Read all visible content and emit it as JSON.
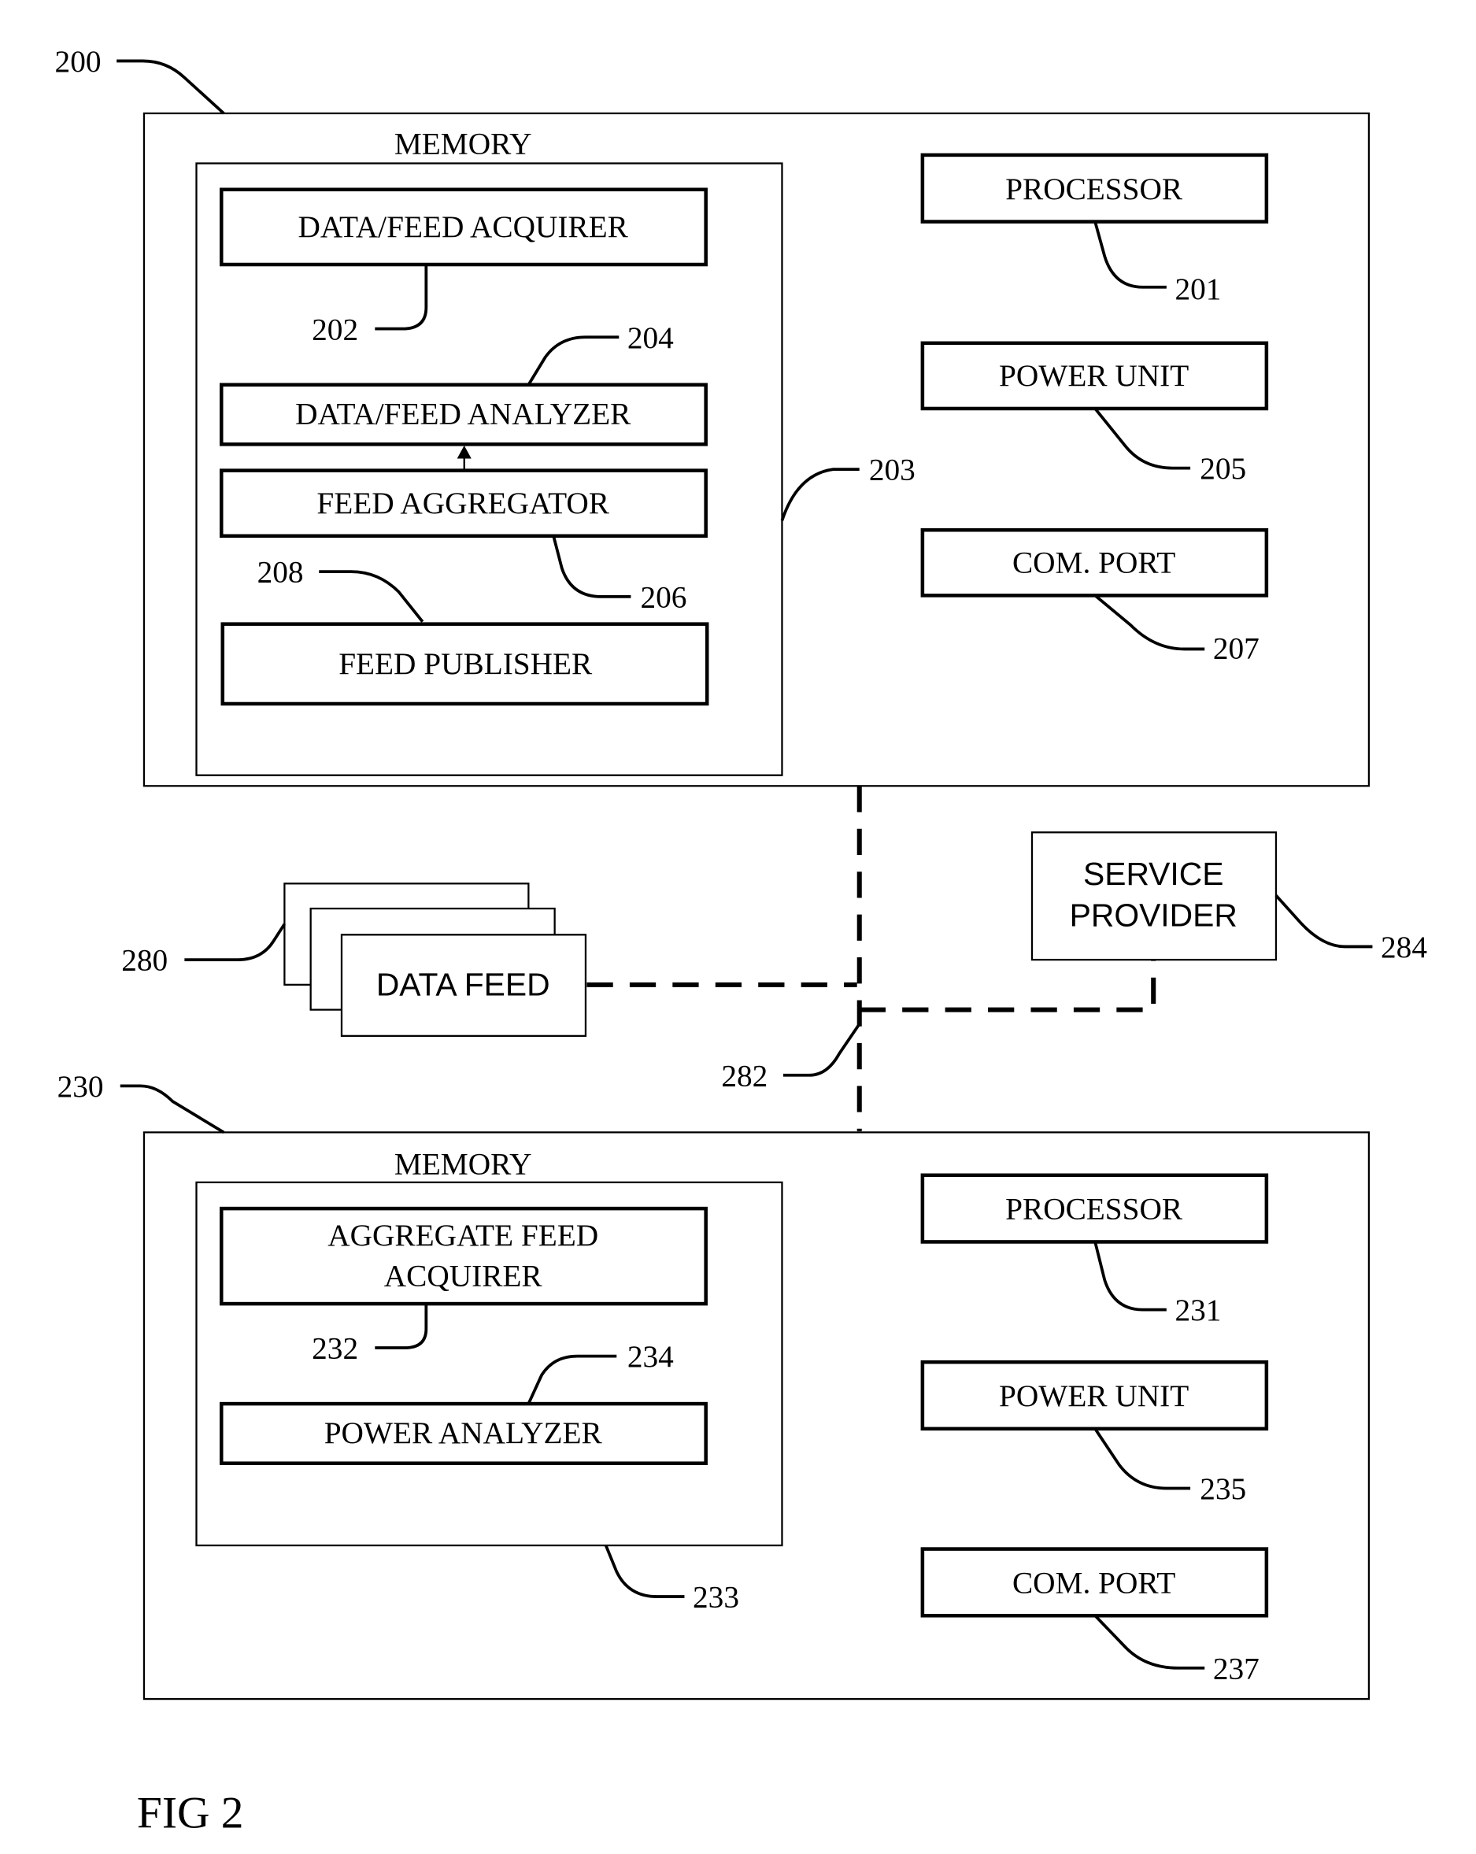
{
  "figure_label": "FIG 2",
  "device_200": {
    "ref": "200",
    "memory": {
      "title": "MEMORY",
      "ref": "203",
      "modules": [
        {
          "label": "DATA/FEED ACQUIRER",
          "ref": "202"
        },
        {
          "label": "DATA/FEED ANALYZER",
          "ref": "204"
        },
        {
          "label": "FEED AGGREGATOR",
          "ref": "206"
        },
        {
          "label": "FEED PUBLISHER",
          "ref": "208"
        }
      ]
    },
    "components": [
      {
        "label": "PROCESSOR",
        "ref": "201"
      },
      {
        "label": "POWER UNIT",
        "ref": "205"
      },
      {
        "label": "COM. PORT",
        "ref": "207"
      }
    ]
  },
  "data_feed": {
    "label": "DATA FEED",
    "ref": "280"
  },
  "network": {
    "ref": "282"
  },
  "service_provider": {
    "label_line1": "SERVICE",
    "label_line2": "PROVIDER",
    "ref": "284"
  },
  "device_230": {
    "ref": "230",
    "memory": {
      "title": "MEMORY",
      "ref": "233",
      "modules": [
        {
          "label_line1": "AGGREGATE FEED",
          "label_line2": "ACQUIRER",
          "ref": "232"
        },
        {
          "label": "POWER ANALYZER",
          "ref": "234"
        }
      ]
    },
    "components": [
      {
        "label": "PROCESSOR",
        "ref": "231"
      },
      {
        "label": "POWER UNIT",
        "ref": "235"
      },
      {
        "label": "COM. PORT",
        "ref": "237"
      }
    ]
  }
}
